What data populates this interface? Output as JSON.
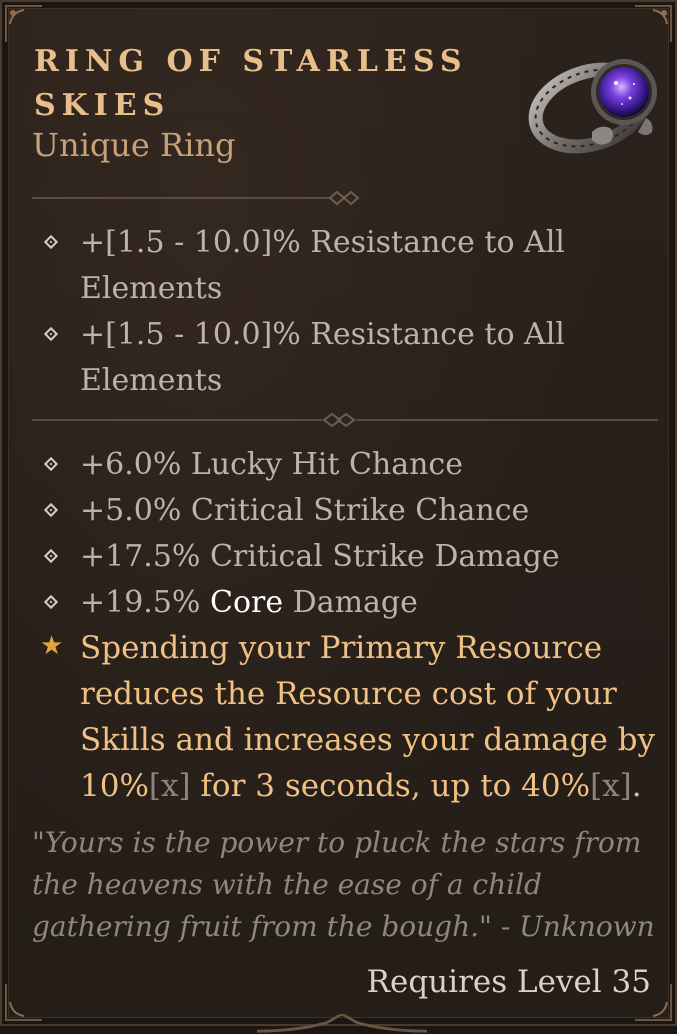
{
  "item": {
    "name": "RING OF STARLESS SKIES",
    "type": "Unique Ring"
  },
  "implicit_affixes": [
    {
      "text": "+[1.5 - 10.0]% Resistance to All Elements"
    },
    {
      "text": "+[1.5 - 10.0]% Resistance to All Elements"
    }
  ],
  "affixes": [
    {
      "text": "+6.0% Lucky Hit Chance"
    },
    {
      "text": "+5.0% Critical Strike Chance"
    },
    {
      "text": "+17.5% Critical Strike Damage"
    },
    {
      "prefix": "+19.5% ",
      "highlight": "Core",
      "suffix": " Damage"
    }
  ],
  "unique_power": {
    "part1": "Spending your Primary Resource reduces the Resource cost of your Skills and increases your damage by 10%",
    "bracket1": "[x]",
    "part2": " for 3 seconds, up to 40%",
    "bracket2": "[x]",
    "part3": "."
  },
  "flavor_text": "\"Yours is the power to pluck the stars from the heavens with the ease of a child gathering fruit from the bough.\" - Unknown",
  "requirement": "Requires Level 35",
  "icons": {
    "ring": "ring-of-starless-skies-icon",
    "bullet": "diamond-bullet-icon",
    "unique": "star-icon"
  },
  "colors": {
    "name": "#e8bf8b",
    "type": "#c7a179",
    "affix": "#bcb3ab",
    "highlight": "#ffffff",
    "unique": "#f0c182",
    "star": "#e6a23a",
    "flavor": "#8f877f",
    "background": "#271f1a"
  }
}
